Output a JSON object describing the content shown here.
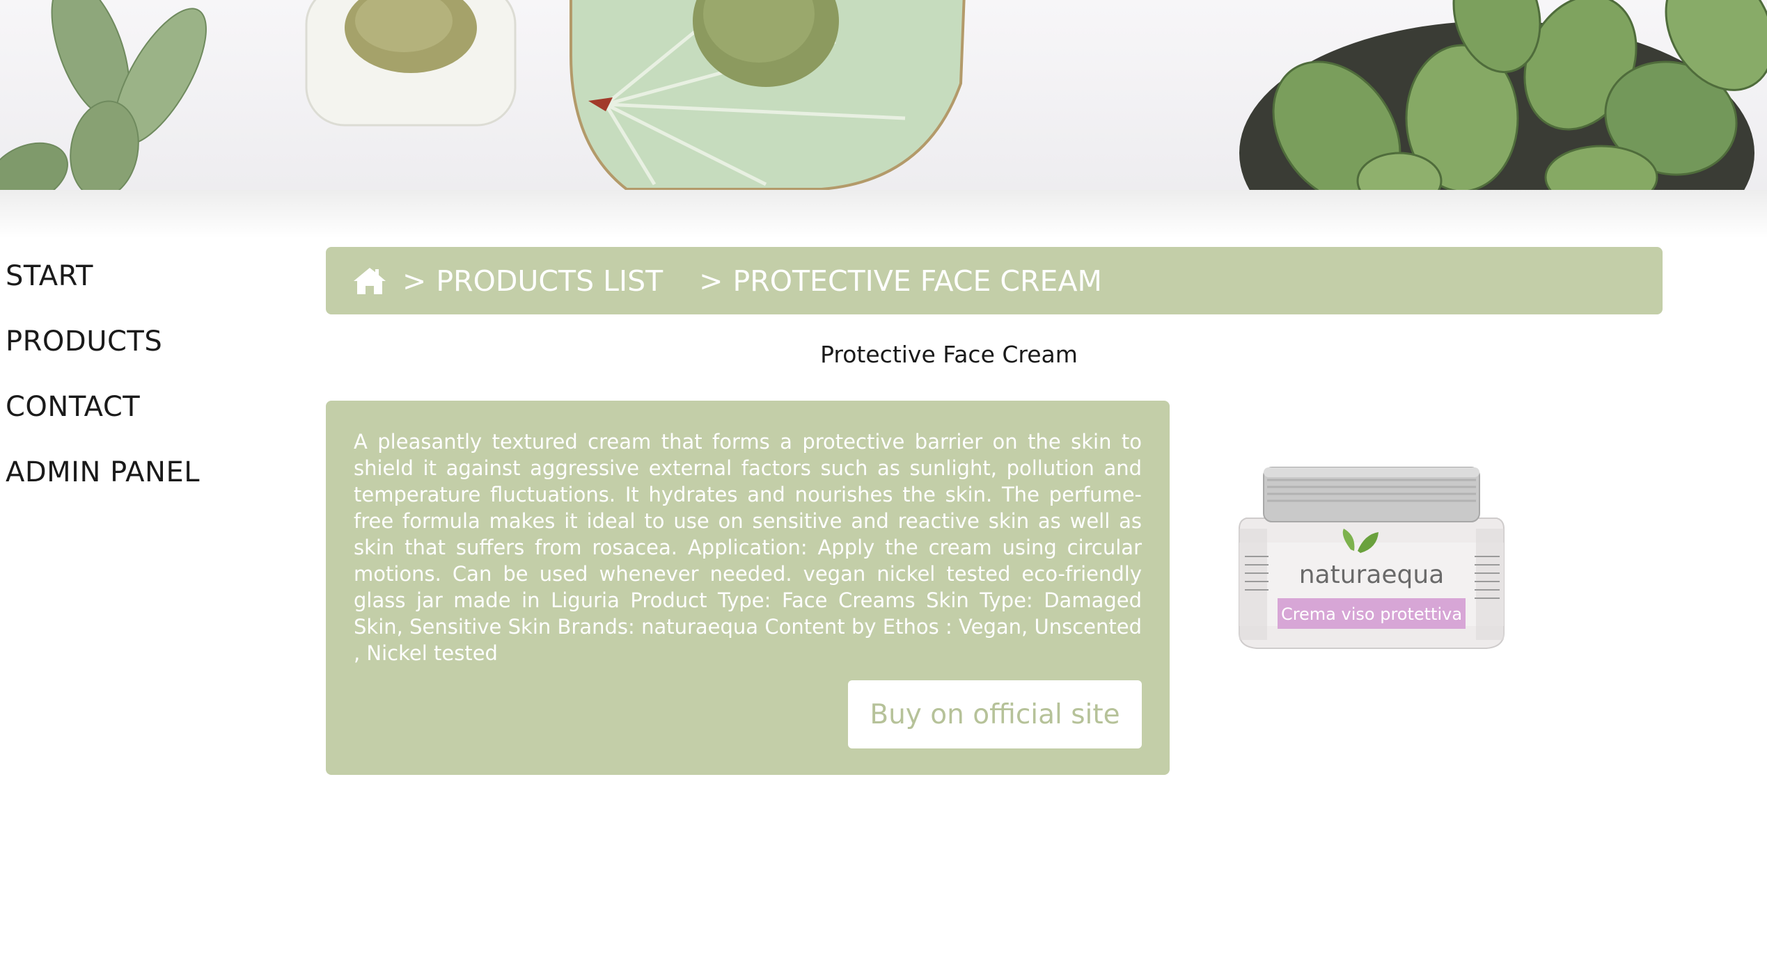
{
  "nav": {
    "items": [
      {
        "label": "START"
      },
      {
        "label": "PRODUCTS"
      },
      {
        "label": "CONTACT"
      },
      {
        "label": "ADMIN PANEL"
      }
    ]
  },
  "breadcrumb": {
    "home_icon": "home-icon",
    "separator": ">",
    "items": [
      {
        "label": "PRODUCTS LIST"
      },
      {
        "label": "PROTECTIVE FACE CREAM"
      }
    ]
  },
  "product": {
    "title": "Protective Face Cream",
    "description": "A pleasantly textured cream that forms a protective barrier on the skin to shield it against aggressive external factors such as sunlight, pollution and temperature fluctuations. It hydrates and nourishes the skin. The perfume-free formula makes it ideal to use on sensitive and reactive skin as well as skin that suffers from rosacea. Application: Apply the cream using circular motions. Can be used whenever needed. vegan nickel tested eco-friendly glass jar made in Liguria Product Type: Face Creams Skin Type: Damaged Skin, Sensitive Skin Brands: naturaequa Content by Ethos : Vegan, Unscented , Nickel tested",
    "buy_label": "Buy on official site",
    "image": {
      "brand": "naturaequa",
      "label": "Crema viso protettiva"
    }
  },
  "colors": {
    "accent": "#c3cea8",
    "button_text": "#b6c299",
    "text": "#1a1a1a"
  }
}
